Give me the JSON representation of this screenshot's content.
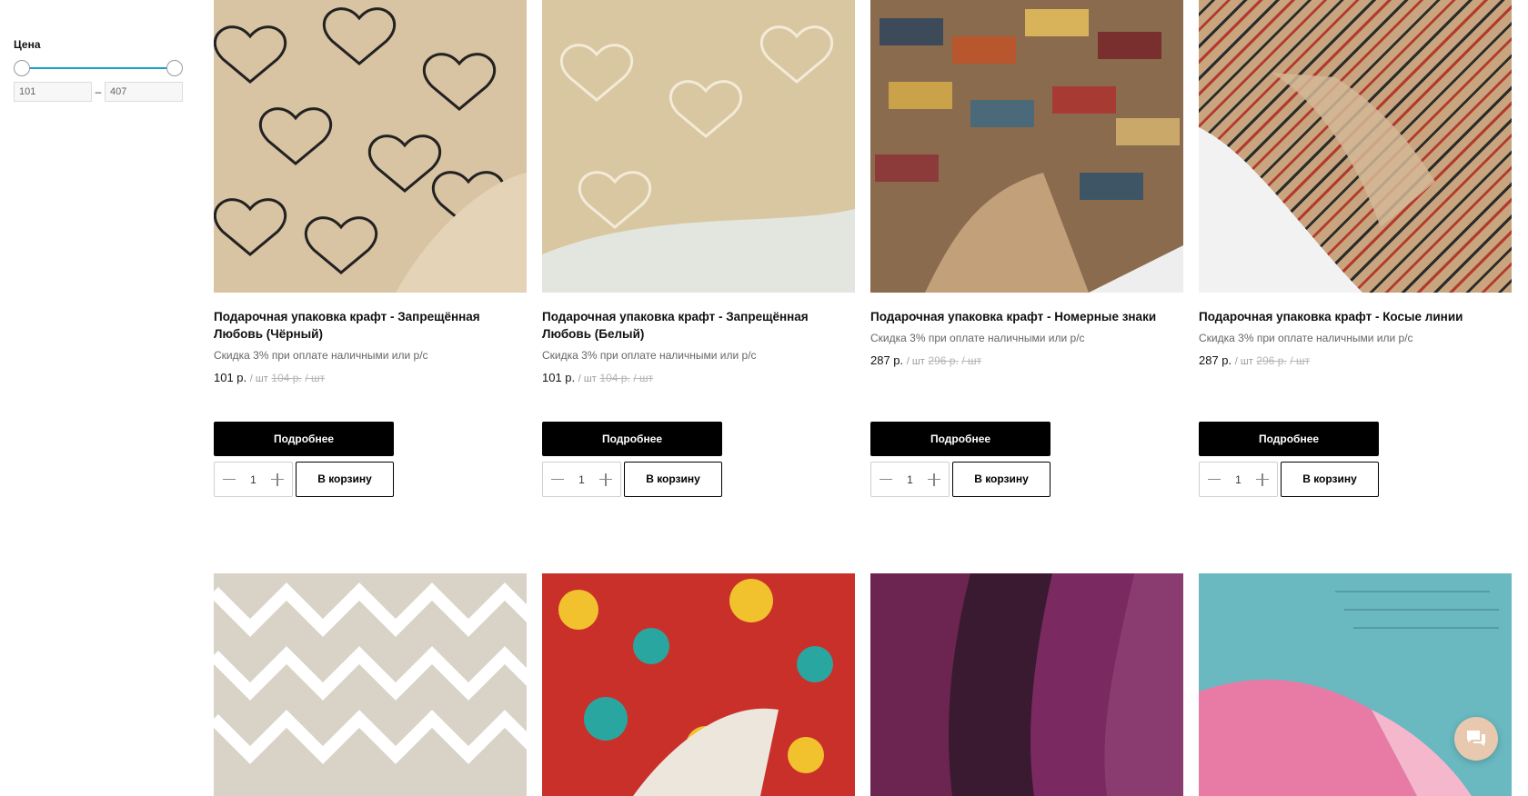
{
  "filter": {
    "title": "Цена",
    "min_value": "101",
    "max_value": "407",
    "dash": "–"
  },
  "products": [
    {
      "title": "Подарочная упаковка крафт - Запрещённая Любовь (Чёрный)",
      "discount": "Скидка 3% при оплате наличными или р/с",
      "price": "101 р.",
      "unit": "/ шт",
      "old_price": "104 р.",
      "old_unit": "/ шт",
      "image_icon": "kraft-hearts-black-image",
      "details_label": "Подробнее",
      "qty": "1",
      "cart_label": "В корзину"
    },
    {
      "title": "Подарочная упаковка крафт - Запрещённая Любовь (Белый)",
      "discount": "Скидка 3% при оплате наличными или р/с",
      "price": "101 р.",
      "unit": "/ шт",
      "old_price": "104 р.",
      "old_unit": "/ шт",
      "image_icon": "kraft-hearts-white-image",
      "details_label": "Подробнее",
      "qty": "1",
      "cart_label": "В корзину"
    },
    {
      "title": "Подарочная упаковка крафт - Номерные знаки",
      "discount": "Скидка 3% при оплате наличными или р/с",
      "price": "287 р.",
      "unit": "/ шт",
      "old_price": "296 р.",
      "old_unit": "/ шт",
      "image_icon": "kraft-license-plates-image",
      "details_label": "Подробнее",
      "qty": "1",
      "cart_label": "В корзину"
    },
    {
      "title": "Подарочная упаковка крафт - Косые линии",
      "discount": "Скидка 3% при оплате наличными или р/с",
      "price": "287 р.",
      "unit": "/ шт",
      "old_price": "296 р.",
      "old_unit": "/ шт",
      "image_icon": "kraft-diagonal-lines-image",
      "details_label": "Подробнее",
      "qty": "1",
      "cart_label": "В корзину"
    }
  ],
  "second_row_images": [
    "chevron-paper-image",
    "comic-paper-image",
    "purple-paper-image",
    "teal-paper-image"
  ],
  "chat_icon": "chat-icon"
}
